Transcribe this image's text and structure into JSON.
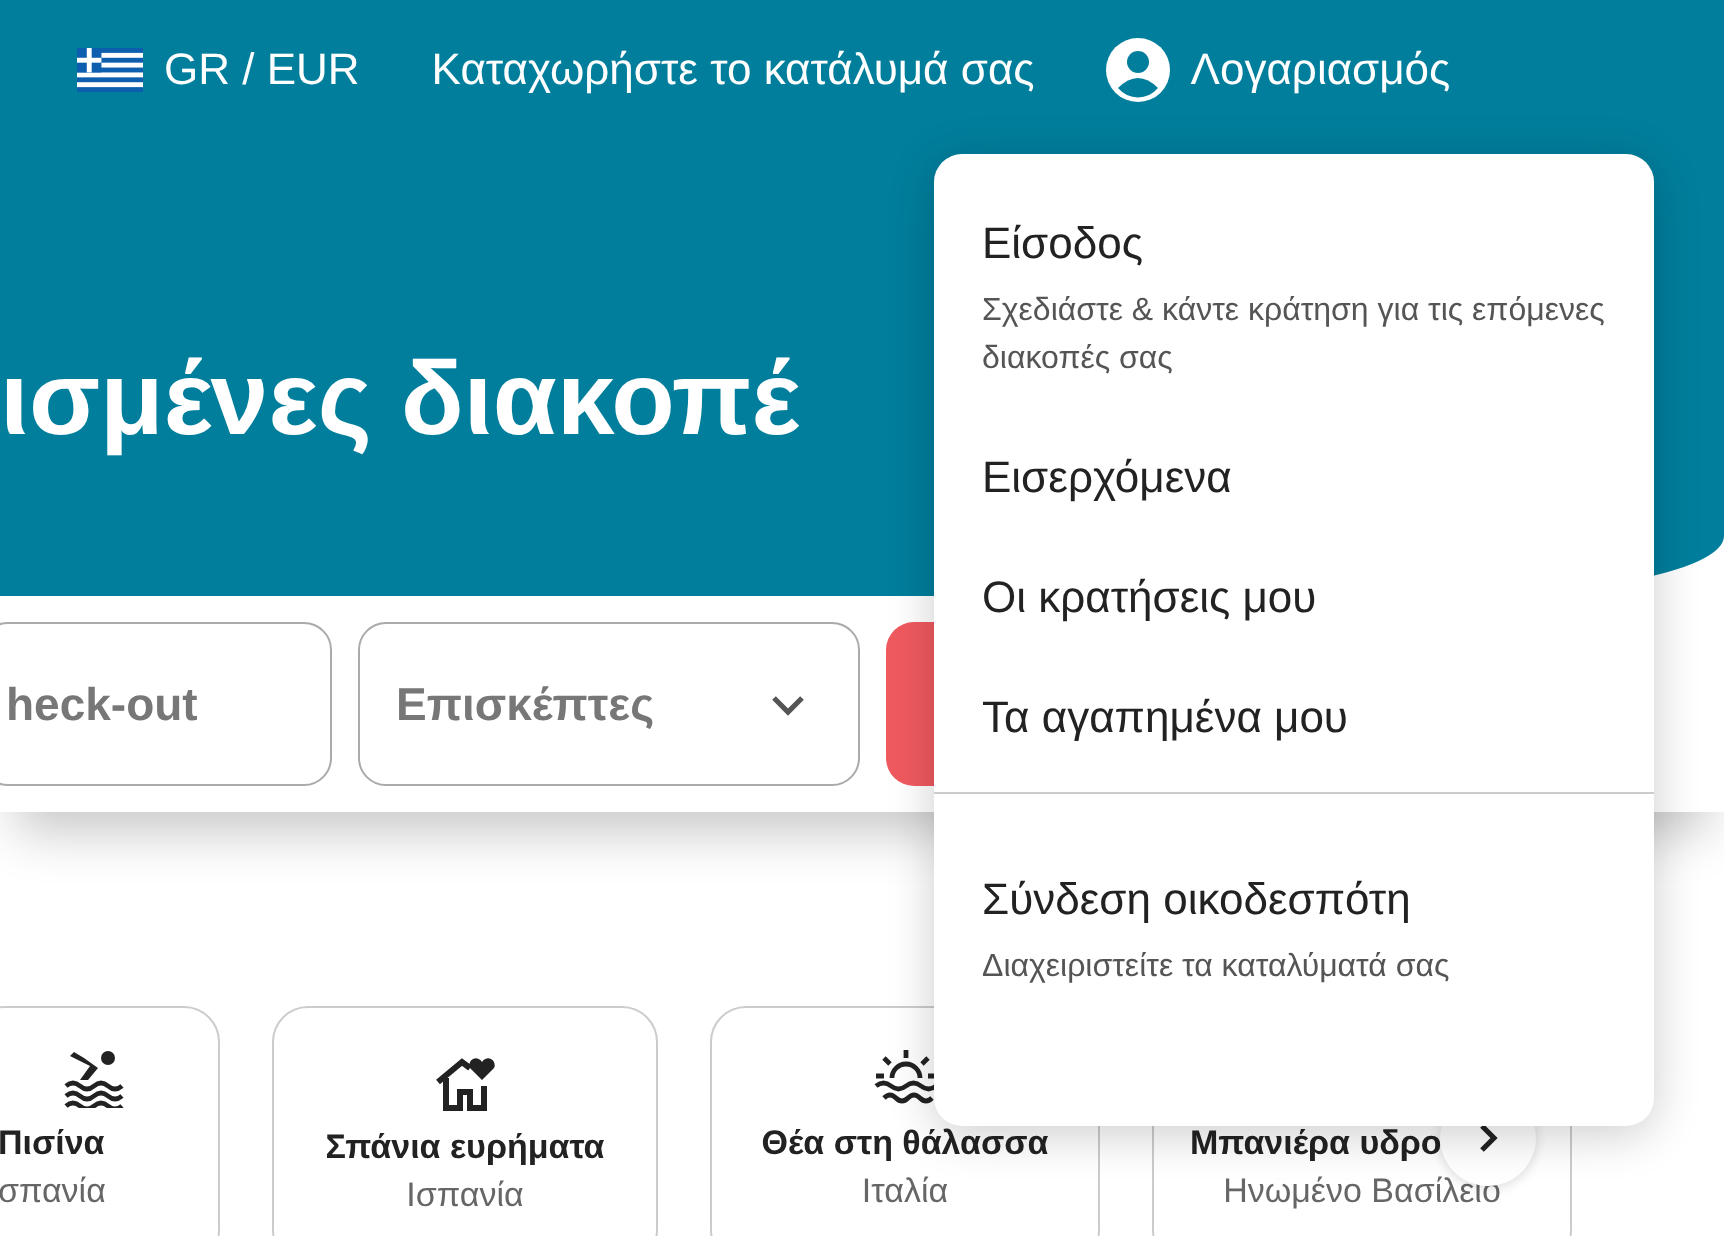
{
  "top_bar": {
    "currency": "GR / EUR",
    "list_property": "Καταχωρήστε το κατάλυμά σας",
    "account": "Λογαριασμός"
  },
  "hero": {
    "heading": "ισμένες διακοπέ"
  },
  "search": {
    "checkout_placeholder": "heck-out",
    "guests_placeholder": "Επισκέπτες"
  },
  "categories": [
    {
      "kind": "pool",
      "title": "Πισίνα",
      "subtitle": "σπανία"
    },
    {
      "kind": "deals",
      "title": "Σπάνια ευρήματα",
      "subtitle": "Ισπανία"
    },
    {
      "kind": "sea",
      "title": "Θέα στη θάλασσα",
      "subtitle": "Ιταλία"
    },
    {
      "kind": "hidden",
      "title": "Μπανιέρα υδρο",
      "subtitle": "Ηνωμένο Βασίλειο"
    }
  ],
  "account_menu": {
    "sections": [
      [
        {
          "label": "Είσοδος",
          "description": "Σχεδιάστε & κάντε κράτηση για τις επόμενες διακοπές σας"
        },
        {
          "label": "Εισερχόμενα"
        },
        {
          "label": "Οι κρατήσεις μου"
        },
        {
          "label": "Τα αγαπημένα μου"
        }
      ],
      [
        {
          "label": "Σύνδεση οικοδεσπότη",
          "description": "Διαχειριστείτε τα καταλύματά σας"
        }
      ]
    ]
  }
}
